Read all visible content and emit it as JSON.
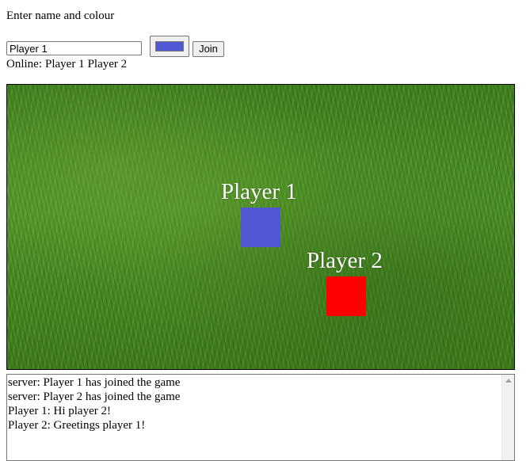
{
  "prompt": "Enter name and colour",
  "join_form": {
    "name_value": "Player 1",
    "color_value": "#5058d4",
    "join_label": "Join"
  },
  "online": {
    "label": "Online:",
    "players": [
      "Player 1",
      "Player 2"
    ]
  },
  "game": {
    "players": [
      {
        "name": "Player 1",
        "color": "#5058d4"
      },
      {
        "name": "Player 2",
        "color": "#ff0000"
      }
    ]
  },
  "chat": {
    "lines": [
      "server: Player 1 has joined the game",
      "server: Player 2 has joined the game",
      "Player 1: Hi player 2!",
      "Player 2: Greetings player 1!"
    ]
  }
}
